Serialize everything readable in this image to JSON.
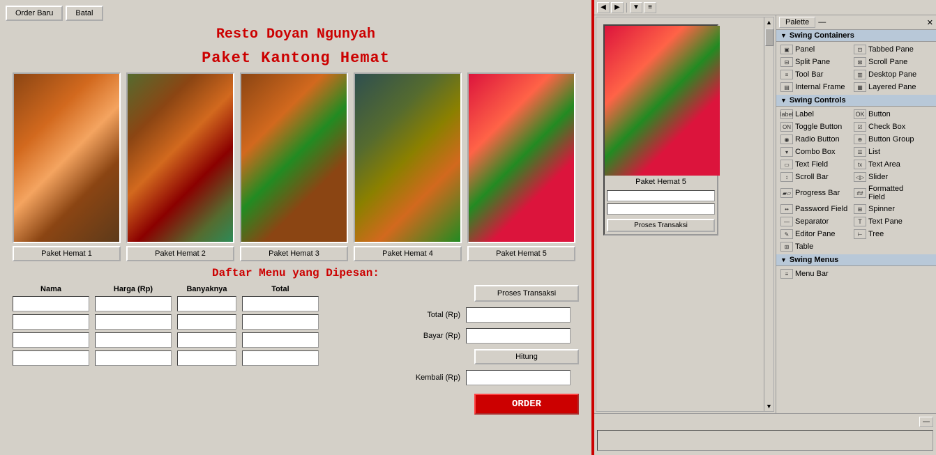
{
  "app": {
    "title": "Resto Doyan Ngunyah",
    "subtitle": "Paket Kantong Hemat",
    "order_section_title": "Daftar Menu yang Dipesan:"
  },
  "toolbar": {
    "order_baru": "Order Baru",
    "batal": "Batal"
  },
  "packages": [
    {
      "id": 1,
      "label": "Paket Hemat 1",
      "img_class": "food-img-1"
    },
    {
      "id": 2,
      "label": "Paket Hemat 2",
      "img_class": "food-img-2"
    },
    {
      "id": 3,
      "label": "Paket Hemat 3",
      "img_class": "food-img-3"
    },
    {
      "id": 4,
      "label": "Paket Hemat 4",
      "img_class": "food-img-4"
    },
    {
      "id": 5,
      "label": "Paket Hemat 5",
      "img_class": "food-img-5"
    }
  ],
  "table": {
    "headers": [
      "Nama",
      "Harga (Rp)",
      "Banyaknya",
      "Total"
    ],
    "rows": 4
  },
  "controls": {
    "proses_transaksi": "Proses Transaksi",
    "total_label": "Total (Rp)",
    "bayar_label": "Bayar (Rp)",
    "kembali_label": "Kembali (Rp)",
    "hitung": "Hitung",
    "order": "ORDER"
  },
  "palette": {
    "title": "Palette",
    "sections": [
      {
        "name": "Swing Containers",
        "items": [
          {
            "label": "Panel",
            "icon": "▣"
          },
          {
            "label": "Tabbed Pane",
            "icon": "⊡"
          },
          {
            "label": "Split Pane",
            "icon": "⊟"
          },
          {
            "label": "Scroll Pane",
            "icon": "⊠"
          },
          {
            "label": "Tool Bar",
            "icon": "≡"
          },
          {
            "label": "Desktop Pane",
            "icon": "▥"
          },
          {
            "label": "Internal Frame",
            "icon": "▤"
          },
          {
            "label": "Layered Pane",
            "icon": "▦"
          }
        ]
      },
      {
        "name": "Swing Controls",
        "items": [
          {
            "label": "Label",
            "icon": "A"
          },
          {
            "label": "Button",
            "icon": "▭"
          },
          {
            "label": "Toggle Button",
            "icon": "◫"
          },
          {
            "label": "Check Box",
            "icon": "☑"
          },
          {
            "label": "Radio Button",
            "icon": "◉"
          },
          {
            "label": "Button Group",
            "icon": "⊕"
          },
          {
            "label": "Combo Box",
            "icon": "▾"
          },
          {
            "label": "List",
            "icon": "☰"
          },
          {
            "label": "Text Field",
            "icon": "▭"
          },
          {
            "label": "Text Area",
            "icon": "▬"
          },
          {
            "label": "Scroll Bar",
            "icon": "↕"
          },
          {
            "label": "Slider",
            "icon": "◁▷"
          },
          {
            "label": "Progress Bar",
            "icon": "▰"
          },
          {
            "label": "Formatted Field",
            "icon": "▭"
          },
          {
            "label": "Password Field",
            "icon": "•••"
          },
          {
            "label": "Spinner",
            "icon": "⊞"
          },
          {
            "label": "Separator",
            "icon": "—"
          },
          {
            "label": "Text Pane",
            "icon": "T"
          },
          {
            "label": "Editor Pane",
            "icon": "✎"
          },
          {
            "label": "Tree",
            "icon": "🌲"
          },
          {
            "label": "Table",
            "icon": "⊞"
          }
        ]
      },
      {
        "name": "Swing Menus",
        "items": [
          {
            "label": "Menu Bar",
            "icon": "≡"
          }
        ]
      }
    ]
  },
  "designer": {
    "paket5_label": "Paket Hemat 5",
    "proses_btn": "Proses Transaksi"
  }
}
